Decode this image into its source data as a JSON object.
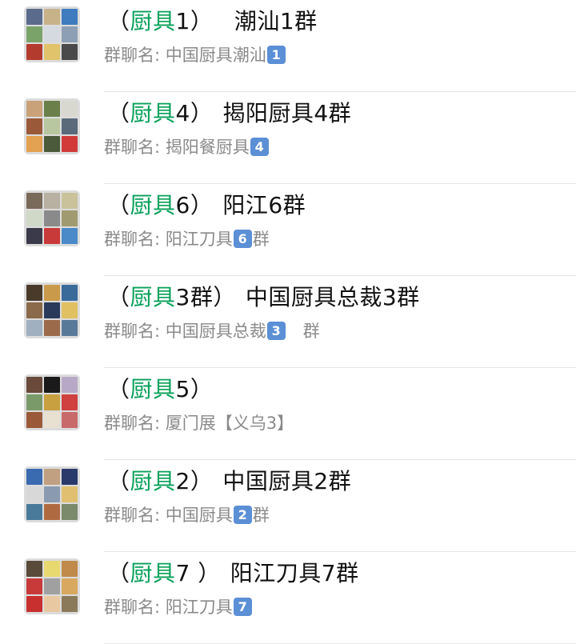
{
  "groups": [
    {
      "keyword": "厨具",
      "suffix": "1）",
      "name": "　潮汕1群",
      "sub_prefix": "群聊名: 中国厨具潮汕",
      "badge": "1",
      "sub_suffix": "",
      "colors": [
        "#5a6b8c",
        "#c7b28a",
        "#3e7bbf",
        "#7aa36a",
        "#d5d9e0",
        "#8c9fb5",
        "#b33b2e",
        "#e0c36a",
        "#4a4a4a"
      ]
    },
    {
      "keyword": "厨具",
      "suffix": "4）",
      "name": "揭阳厨具4群",
      "sub_prefix": "群聊名: 揭阳餐厨具",
      "badge": "4",
      "sub_suffix": "",
      "colors": [
        "#c9a27a",
        "#6b7f4a",
        "#d8d8d0",
        "#9a5a3a",
        "#b8c7a0",
        "#5a6a7a",
        "#e2a050",
        "#4a5a3a",
        "#d23a3a"
      ]
    },
    {
      "keyword": "厨具",
      "suffix": "6）",
      "name": "阳江6群",
      "sub_prefix": "群聊名: 阳江刀具",
      "badge": "6",
      "sub_suffix": "群",
      "colors": [
        "#7a6a5a",
        "#b8b0a0",
        "#c9c29a",
        "#d0d8c8",
        "#8a8a8a",
        "#a09a70",
        "#3a3a4a",
        "#c83a3a",
        "#4a8ac8"
      ]
    },
    {
      "keyword": "厨具",
      "suffix": "3群）",
      "name": "中国厨具总裁3群",
      "sub_prefix": "群聊名: 中国厨具总裁",
      "badge": "3",
      "sub_suffix": "　群",
      "colors": [
        "#4a3a2a",
        "#c89a4a",
        "#3a6a9a",
        "#8a6a4a",
        "#2a3a5a",
        "#e0c060",
        "#a0b0c0",
        "#9a6a4a",
        "#5a7a9a"
      ]
    },
    {
      "keyword": "厨具",
      "suffix": "5）",
      "name": "",
      "sub_prefix": "群聊名: 厦门展【义乌3】",
      "badge": "",
      "sub_suffix": "",
      "colors": [
        "#6a4a3a",
        "#1a1a1a",
        "#b8a8c8",
        "#7a9a6a",
        "#c8a040",
        "#d04040",
        "#9a5a3a",
        "#e8e0d0",
        "#c86a6a"
      ]
    },
    {
      "keyword": "厨具",
      "suffix": "2）",
      "name": "中国厨具2群",
      "sub_prefix": "群聊名: 中国厨具",
      "badge": "2",
      "sub_suffix": "群",
      "colors": [
        "#3a6ab0",
        "#c0a080",
        "#2a3a6a",
        "#d8d8d8",
        "#8a9ab0",
        "#e0c070",
        "#4a7a9a",
        "#b06a40",
        "#7a8a6a"
      ]
    },
    {
      "keyword": "厨具",
      "suffix": "7 ）",
      "name": "阳江刀具7群",
      "sub_prefix": "群聊名: 阳江刀具",
      "badge": "7",
      "sub_suffix": "",
      "colors": [
        "#5a4a3a",
        "#e8d870",
        "#c08a4a",
        "#c83a3a",
        "#a0a0a0",
        "#d8a860",
        "#c83030",
        "#e8c8a0",
        "#8a7a5a"
      ]
    }
  ]
}
